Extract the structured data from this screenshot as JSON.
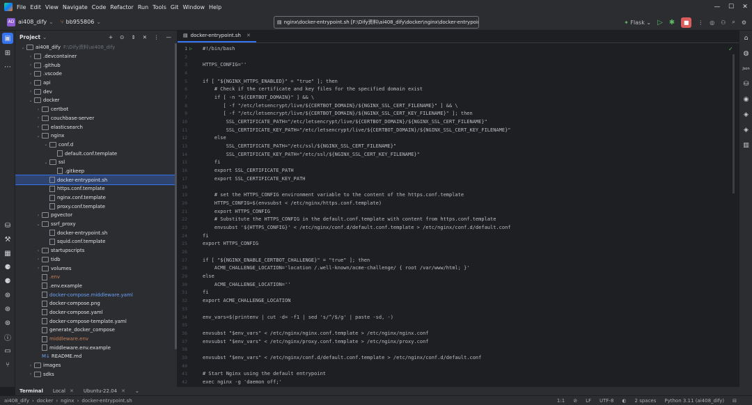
{
  "menu": [
    "File",
    "Edit",
    "View",
    "Navigate",
    "Code",
    "Refactor",
    "Run",
    "Tools",
    "Git",
    "Window",
    "Help"
  ],
  "toolbar": {
    "project_badge": "AD",
    "project": "ai408_dify",
    "branch": "bb955806",
    "path": "nginx\\docker-entrypoint.sh [F:\\Dify资料\\ai408_dify\\docker\\nginx\\docker-entrypoint.sh]",
    "run_config": "Flask"
  },
  "project_panel": {
    "title": "Project",
    "root": "ai408_dify",
    "root_path": "F:\\Dify资料\\ai408_dify"
  },
  "tree": [
    {
      "depth": 0,
      "arrow": "v",
      "icon": "folder",
      "label": "ai408_dify",
      "extra": "F:\\Dify资料\\ai408_dify"
    },
    {
      "depth": 1,
      "arrow": ">",
      "icon": "folder",
      "label": ".devcontainer"
    },
    {
      "depth": 1,
      "arrow": ">",
      "icon": "folder",
      "label": ".github"
    },
    {
      "depth": 1,
      "arrow": ">",
      "icon": "folder",
      "label": ".vscode"
    },
    {
      "depth": 1,
      "arrow": ">",
      "icon": "folder",
      "label": "api"
    },
    {
      "depth": 1,
      "arrow": ">",
      "icon": "folder",
      "label": "dev"
    },
    {
      "depth": 1,
      "arrow": "v",
      "icon": "folder",
      "label": "docker"
    },
    {
      "depth": 2,
      "arrow": ">",
      "icon": "folder",
      "label": "certbot"
    },
    {
      "depth": 2,
      "arrow": ">",
      "icon": "folder",
      "label": "couchbase-server"
    },
    {
      "depth": 2,
      "arrow": ">",
      "icon": "folder",
      "label": "elasticsearch"
    },
    {
      "depth": 2,
      "arrow": "v",
      "icon": "folder",
      "label": "nginx"
    },
    {
      "depth": 3,
      "arrow": "v",
      "icon": "folder",
      "label": "conf.d"
    },
    {
      "depth": 4,
      "arrow": "",
      "icon": "file",
      "label": "default.conf.template"
    },
    {
      "depth": 3,
      "arrow": "v",
      "icon": "folder",
      "label": "ssl"
    },
    {
      "depth": 4,
      "arrow": "",
      "icon": "file",
      "label": ".gitkeep"
    },
    {
      "depth": 3,
      "arrow": "",
      "icon": "file",
      "label": "docker-entrypoint.sh",
      "selected": true
    },
    {
      "depth": 3,
      "arrow": "",
      "icon": "file",
      "label": "https.conf.template"
    },
    {
      "depth": 3,
      "arrow": "",
      "icon": "file",
      "label": "nginx.conf.template"
    },
    {
      "depth": 3,
      "arrow": "",
      "icon": "file",
      "label": "proxy.conf.template"
    },
    {
      "depth": 2,
      "arrow": ">",
      "icon": "folder",
      "label": "pgvector"
    },
    {
      "depth": 2,
      "arrow": "v",
      "icon": "folder",
      "label": "ssrf_proxy"
    },
    {
      "depth": 3,
      "arrow": "",
      "icon": "file",
      "label": "docker-entrypoint.sh"
    },
    {
      "depth": 3,
      "arrow": "",
      "icon": "file",
      "label": "squid.conf.template"
    },
    {
      "depth": 2,
      "arrow": ">",
      "icon": "folder",
      "label": "startupscripts"
    },
    {
      "depth": 2,
      "arrow": ">",
      "icon": "folder",
      "label": "tidb"
    },
    {
      "depth": 2,
      "arrow": ">",
      "icon": "folder",
      "label": "volumes"
    },
    {
      "depth": 2,
      "arrow": "",
      "icon": "file",
      "label": ".env",
      "color": "orange"
    },
    {
      "depth": 2,
      "arrow": "",
      "icon": "file",
      "label": ".env.example"
    },
    {
      "depth": 2,
      "arrow": "",
      "icon": "file",
      "label": "docker-compose.middleware.yaml",
      "color": "blue"
    },
    {
      "depth": 2,
      "arrow": "",
      "icon": "file",
      "label": "docker-compose.png"
    },
    {
      "depth": 2,
      "arrow": "",
      "icon": "file",
      "label": "docker-compose.yaml"
    },
    {
      "depth": 2,
      "arrow": "",
      "icon": "file",
      "label": "docker-compose-template.yaml"
    },
    {
      "depth": 2,
      "arrow": "",
      "icon": "file",
      "label": "generate_docker_compose"
    },
    {
      "depth": 2,
      "arrow": "",
      "icon": "file",
      "label": "middleware.env",
      "color": "orange"
    },
    {
      "depth": 2,
      "arrow": "",
      "icon": "file",
      "label": "middleware.env.example"
    },
    {
      "depth": 2,
      "arrow": "",
      "icon": "file",
      "label": "README.md",
      "prefix": "M↓"
    },
    {
      "depth": 1,
      "arrow": ">",
      "icon": "folder",
      "label": "images"
    },
    {
      "depth": 1,
      "arrow": ">",
      "icon": "folder",
      "label": "sdks"
    }
  ],
  "editor": {
    "tab": "docker-entrypoint.sh"
  },
  "code": [
    {
      "n": "1",
      "t": "#!/bin/bash"
    },
    {
      "n": "2",
      "t": ""
    },
    {
      "n": "3",
      "t": "HTTPS_CONFIG=''"
    },
    {
      "n": "4",
      "t": ""
    },
    {
      "n": "5",
      "t": "if [ \"${NGINX_HTTPS_ENABLED}\" = \"true\" ]; then"
    },
    {
      "n": "6",
      "t": "    # Check if the certificate and key files for the specified domain exist"
    },
    {
      "n": "7",
      "t": "    if [ -n \"${CERTBOT_DOMAIN}\" ] && \\"
    },
    {
      "n": "8",
      "t": "       [ -f \"/etc/letsencrypt/live/${CERTBOT_DOMAIN}/${NGINX_SSL_CERT_FILENAME}\" ] && \\"
    },
    {
      "n": "9",
      "t": "       [ -f \"/etc/letsencrypt/live/${CERTBOT_DOMAIN}/${NGINX_SSL_CERT_KEY_FILENAME}\" ]; then"
    },
    {
      "n": "10",
      "t": "        SSL_CERTIFICATE_PATH=\"/etc/letsencrypt/live/${CERTBOT_DOMAIN}/${NGINX_SSL_CERT_FILENAME}\""
    },
    {
      "n": "11",
      "t": "        SSL_CERTIFICATE_KEY_PATH=\"/etc/letsencrypt/live/${CERTBOT_DOMAIN}/${NGINX_SSL_CERT_KEY_FILENAME}\""
    },
    {
      "n": "12",
      "t": "    else"
    },
    {
      "n": "13",
      "t": "        SSL_CERTIFICATE_PATH=\"/etc/ssl/${NGINX_SSL_CERT_FILENAME}\""
    },
    {
      "n": "14",
      "t": "        SSL_CERTIFICATE_KEY_PATH=\"/etc/ssl/${NGINX_SSL_CERT_KEY_FILENAME}\""
    },
    {
      "n": "15",
      "t": "    fi"
    },
    {
      "n": "16",
      "t": "    export SSL_CERTIFICATE_PATH"
    },
    {
      "n": "17",
      "t": "    export SSL_CERTIFICATE_KEY_PATH"
    },
    {
      "n": "18",
      "t": ""
    },
    {
      "n": "19",
      "t": "    # set the HTTPS_CONFIG environment variable to the content of the https.conf.template"
    },
    {
      "n": "20",
      "t": "    HTTPS_CONFIG=$(envsubst < /etc/nginx/https.conf.template)"
    },
    {
      "n": "21",
      "t": "    export HTTPS_CONFIG"
    },
    {
      "n": "22",
      "t": "    # Substitute the HTTPS_CONFIG in the default.conf.template with content from https.conf.template"
    },
    {
      "n": "23",
      "t": "    envsubst '${HTTPS_CONFIG}' < /etc/nginx/conf.d/default.conf.template > /etc/nginx/conf.d/default.conf"
    },
    {
      "n": "24",
      "t": "fi"
    },
    {
      "n": "25",
      "t": "export HTTPS_CONFIG"
    },
    {
      "n": "26",
      "t": ""
    },
    {
      "n": "27",
      "t": "if [ \"${NGINX_ENABLE_CERTBOT_CHALLENGE}\" = \"true\" ]; then"
    },
    {
      "n": "28",
      "t": "    ACME_CHALLENGE_LOCATION='location /.well-known/acme-challenge/ { root /var/www/html; }'"
    },
    {
      "n": "29",
      "t": "else"
    },
    {
      "n": "30",
      "t": "    ACME_CHALLENGE_LOCATION=''"
    },
    {
      "n": "31",
      "t": "fi"
    },
    {
      "n": "32",
      "t": "export ACME_CHALLENGE_LOCATION"
    },
    {
      "n": "33",
      "t": ""
    },
    {
      "n": "34",
      "t": "env_vars=$(printenv | cut -d= -f1 | sed 's/^/$/g' | paste -sd, -)"
    },
    {
      "n": "35",
      "t": ""
    },
    {
      "n": "36",
      "t": "envsubst \"$env_vars\" < /etc/nginx/nginx.conf.template > /etc/nginx/nginx.conf"
    },
    {
      "n": "37",
      "t": "envsubst \"$env_vars\" < /etc/nginx/proxy.conf.template > /etc/nginx/proxy.conf"
    },
    {
      "n": "38",
      "t": ""
    },
    {
      "n": "39",
      "t": "envsubst \"$env_vars\" < /etc/nginx/conf.d/default.conf.template > /etc/nginx/conf.d/default.conf"
    },
    {
      "n": "40",
      "t": ""
    },
    {
      "n": "41",
      "t": "# Start Nginx using the default entrypoint"
    },
    {
      "n": "42",
      "t": "exec nginx -g 'daemon off;'"
    }
  ],
  "bottom": {
    "terminal": "Terminal",
    "local": "Local",
    "ubuntu": "Ubuntu-22.04"
  },
  "status": {
    "crumbs": [
      "ai408_dify",
      "docker",
      "nginx",
      "docker-entrypoint.sh"
    ],
    "position": "1:1",
    "line_sep": "LF",
    "encoding": "UTF-8",
    "indent": "2 spaces",
    "interpreter": "Python 3.11 (ai408_dify)"
  }
}
